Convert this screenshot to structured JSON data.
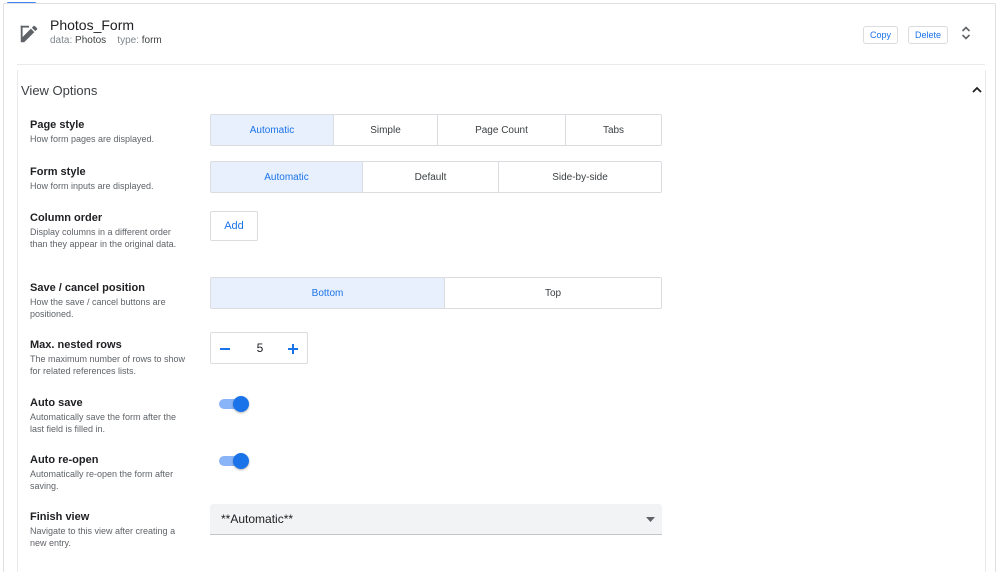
{
  "header": {
    "title": "Photos_Form",
    "data_key": "data:",
    "data_value": "Photos",
    "type_key": "type:",
    "type_value": "form",
    "copy_label": "Copy",
    "delete_label": "Delete"
  },
  "section": {
    "title": "View Options"
  },
  "rows": {
    "page_style": {
      "label": "Page style",
      "desc": "How form pages are displayed.",
      "options": [
        "Automatic",
        "Simple",
        "Page Count",
        "Tabs"
      ],
      "selected": "Automatic"
    },
    "form_style": {
      "label": "Form style",
      "desc": "How form inputs are displayed.",
      "options": [
        "Automatic",
        "Default",
        "Side-by-side"
      ],
      "selected": "Automatic"
    },
    "column_order": {
      "label": "Column order",
      "desc": "Display columns in a different order than they appear in the original data.",
      "button": "Add"
    },
    "save_cancel": {
      "label": "Save / cancel position",
      "desc": "How the save / cancel buttons are positioned.",
      "options": [
        "Bottom",
        "Top"
      ],
      "selected": "Bottom"
    },
    "max_nested": {
      "label": "Max. nested rows",
      "desc": "The maximum number of rows to show for related references lists.",
      "value": "5"
    },
    "auto_save": {
      "label": "Auto save",
      "desc": "Automatically save the form after the last field is filled in.",
      "enabled": true
    },
    "auto_reopen": {
      "label": "Auto re-open",
      "desc": "Automatically re-open the form after saving.",
      "enabled": true
    },
    "finish_view": {
      "label": "Finish view",
      "desc": "Navigate to this view after creating a new entry.",
      "value": "**Automatic**"
    }
  },
  "icons": {
    "edit": "edit-icon",
    "expand": "unfold-icon",
    "collapse": "chevron-up-icon",
    "minus": "minus-icon",
    "plus": "plus-icon",
    "caret": "dropdown-caret-icon"
  },
  "colors": {
    "accent": "#1a73e8",
    "selected_bg": "#e8f0fe",
    "toggle_track": "#8ab4f8"
  }
}
